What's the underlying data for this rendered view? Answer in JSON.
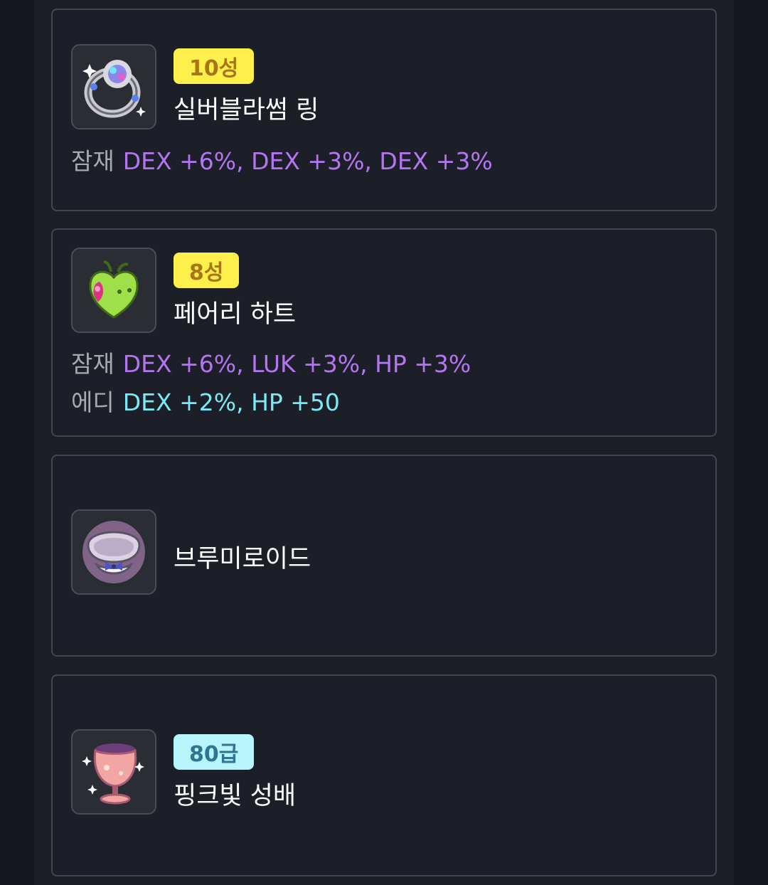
{
  "items": [
    {
      "badge": "10성",
      "name": "실버블라썸 링",
      "potential_label": "잠재",
      "potential": "DEX +6%, DEX +3%, DEX +3%",
      "icon": "ring-icon"
    },
    {
      "badge": "8성",
      "name": "페어리 하트",
      "potential_label": "잠재",
      "potential": "DEX +6%, LUK +3%, HP +3%",
      "additional_label": "에디",
      "additional": "DEX +2%, HP +50",
      "icon": "heart-pendant-icon"
    },
    {
      "name": "브루미로이드",
      "icon": "face-accessory-icon"
    },
    {
      "badge": "80급",
      "name": "핑크빛 성배",
      "icon": "chalice-icon"
    }
  ],
  "colors": {
    "star_badge": "#fdf04a",
    "grade_badge": "#b7f4fb",
    "potential": "#b575f3",
    "additional": "#7aeaf6"
  }
}
